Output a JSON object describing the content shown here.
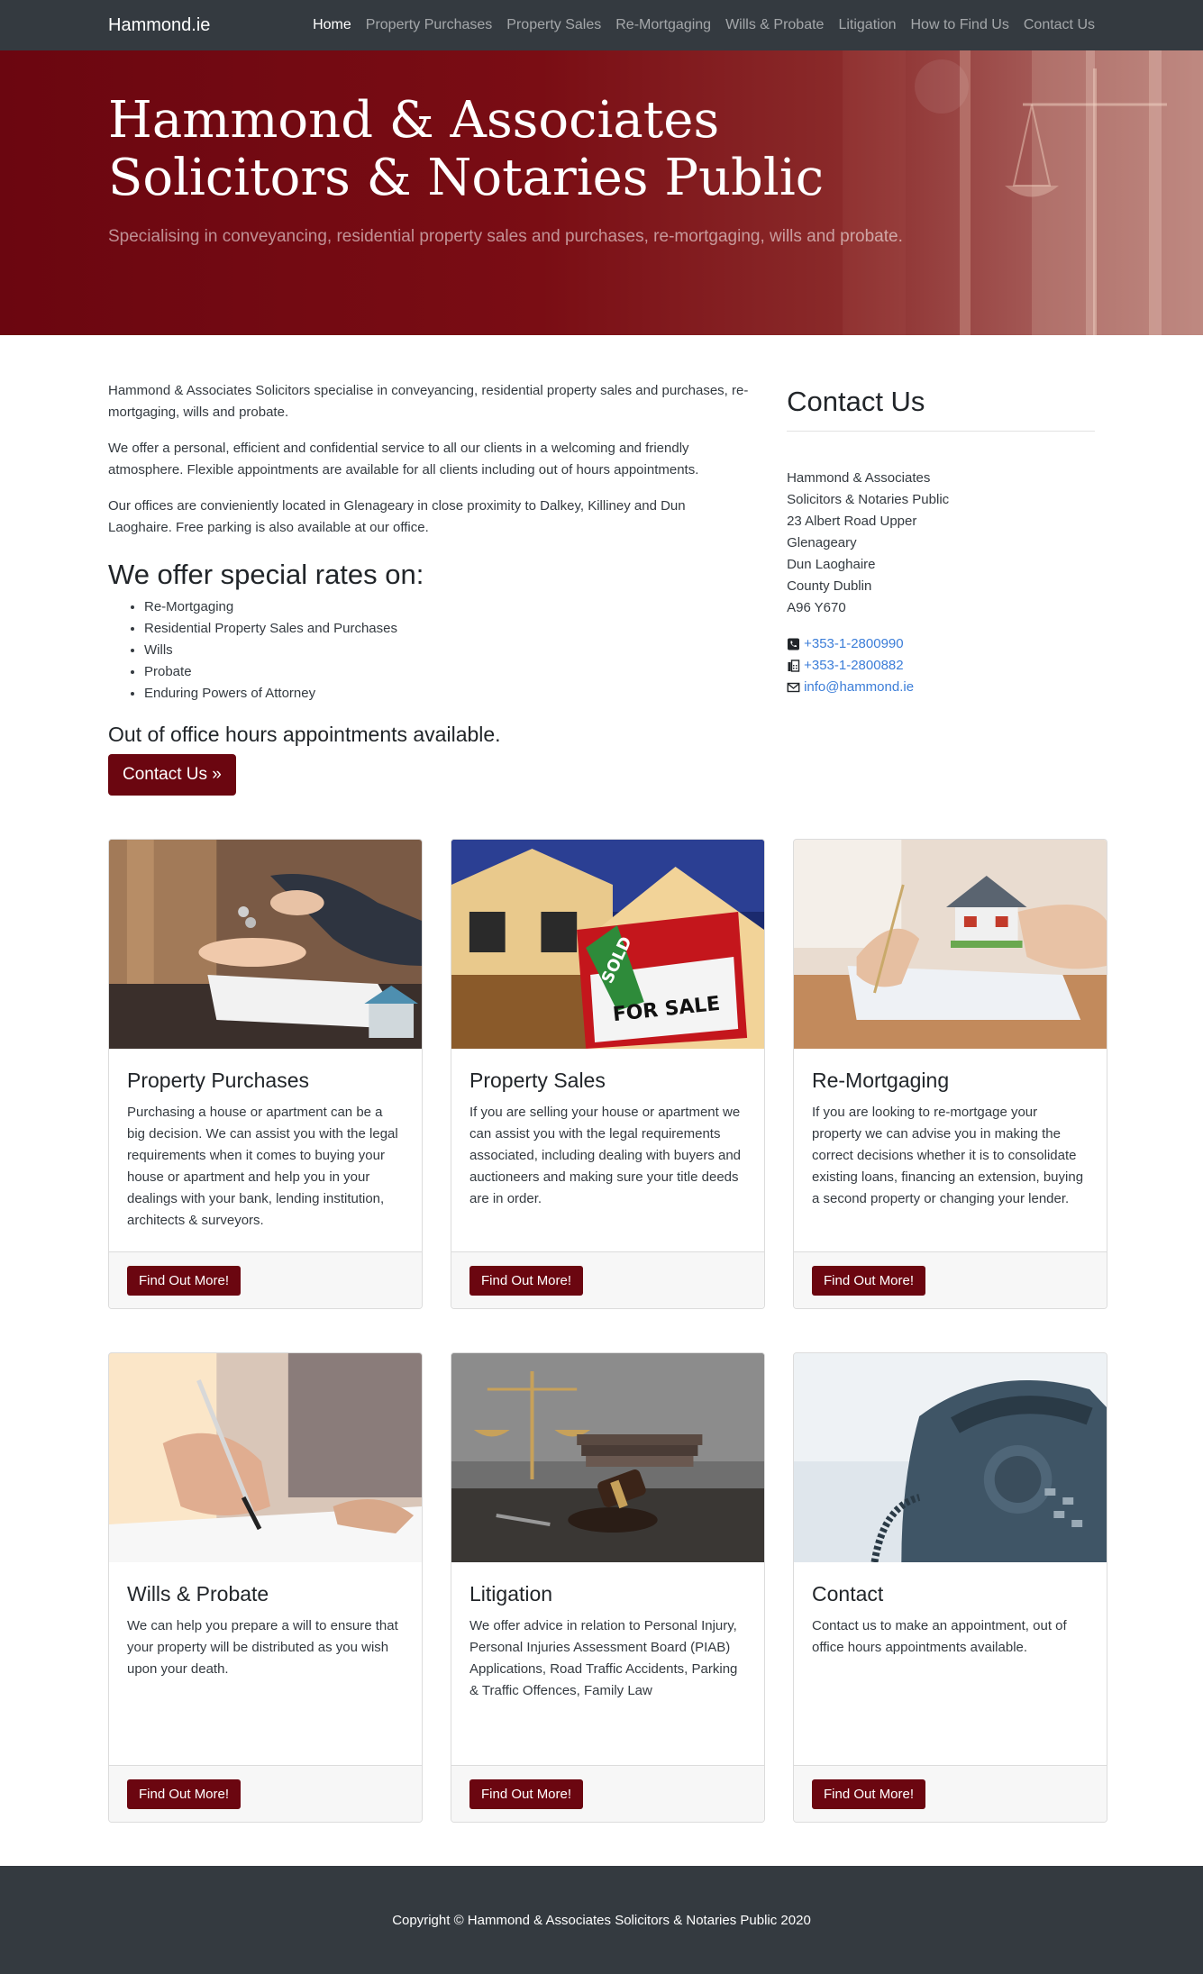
{
  "nav": {
    "brand": "Hammond.ie",
    "items": [
      {
        "label": "Home",
        "active": true
      },
      {
        "label": "Property Purchases"
      },
      {
        "label": "Property Sales"
      },
      {
        "label": "Re-Mortgaging"
      },
      {
        "label": "Wills & Probate"
      },
      {
        "label": "Litigation"
      },
      {
        "label": "How to Find Us"
      },
      {
        "label": "Contact Us"
      }
    ]
  },
  "hero": {
    "title_line1": "Hammond & Associates",
    "title_line2": "Solicitors & Notaries Public",
    "subtitle": "Specialising in conveyancing, residential property sales and purchases, re-mortgaging, wills and probate."
  },
  "intro": {
    "paragraphs": [
      "Hammond & Associates Solicitors specialise in conveyancing, residential property sales and purchases, re-mortgaging, wills and probate.",
      "We offer a personal, efficient and confidential service to all our clients in a welcoming and friendly atmosphere. Flexible appointments are available for all clients including out of hours appointments.",
      "Our offices are convieniently located in Glenageary in close proximity to Dalkey, Killiney and Dun Laoghaire. Free parking is also available at our office."
    ],
    "rates_title": "We offer special rates on:",
    "rates": [
      "Re-Mortgaging",
      "Residential Property Sales and Purchases",
      "Wills",
      "Probate",
      "Enduring Powers of Attorney"
    ],
    "out_of_hours": "Out of office hours appointments available.",
    "contact_button": "Contact Us »"
  },
  "contact": {
    "title": "Contact Us",
    "address": [
      "Hammond & Associates",
      "Solicitors & Notaries Public",
      "23 Albert Road Upper",
      "Glenageary",
      "Dun Laoghaire",
      "County Dublin",
      "A96 Y670"
    ],
    "phone": "+353-1-2800990",
    "fax": "+353-1-2800882",
    "email": "info@hammond.ie"
  },
  "cards": [
    {
      "title": "Property Purchases",
      "text": "Purchasing a house or apartment can be a big decision. We can assist you with the legal requirements when it comes to buying your house or apartment and help you in your dealings with your bank, lending institution, architects & surveyors.",
      "button": "Find Out More!"
    },
    {
      "title": "Property Sales",
      "text": "If you are selling your house or apartment we can assist you with the legal requirements associated, including dealing with buyers and auctioneers and making sure your title deeds are in order.",
      "button": "Find Out More!",
      "image_text_sold": "SOLD",
      "image_text_sale": "FOR SALE"
    },
    {
      "title": "Re-Mortgaging",
      "text": "If you are looking to re-mortgage your property we can advise you in making the correct decisions whether it is to consolidate existing loans, financing an extension, buying a second property or changing your lender.",
      "button": "Find Out More!"
    },
    {
      "title": "Wills & Probate",
      "text": "We can help you prepare a will to ensure that your property will be distributed as you wish upon your death.",
      "button": "Find Out More!"
    },
    {
      "title": "Litigation",
      "text": "We offer advice in relation to Personal Injury, Personal Injuries Assessment Board (PIAB) Applications, Road Traffic Accidents, Parking & Traffic Offences, Family Law",
      "button": "Find Out More!"
    },
    {
      "title": "Contact",
      "text": "Contact us to make an appointment, out of office hours appointments available.",
      "button": "Find Out More!"
    }
  ],
  "footer": {
    "copyright": "Copyright © Hammond & Associates Solicitors & Notaries Public 2020"
  }
}
